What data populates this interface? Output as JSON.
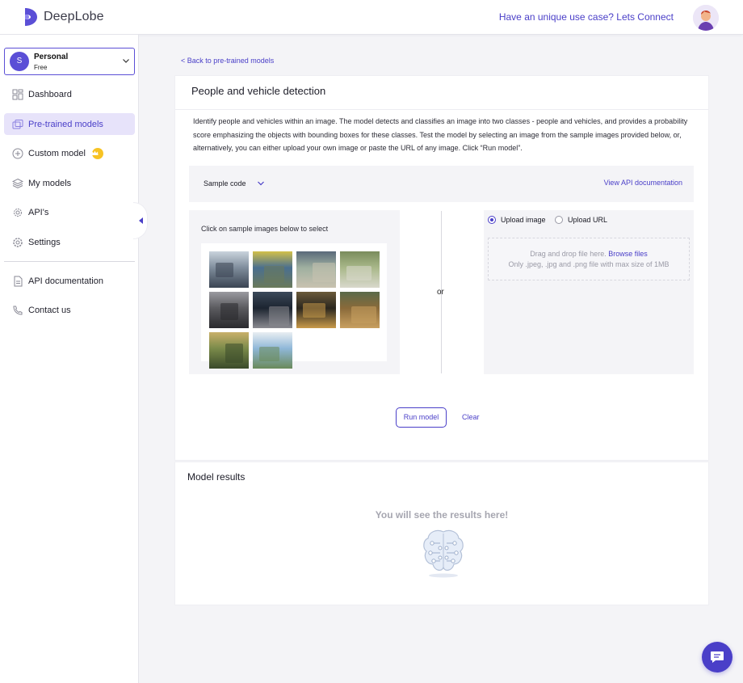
{
  "brand": {
    "name": "DeepLobe",
    "accent": "#4a3fc8",
    "logo_icon": "deeplobe-logo-icon"
  },
  "header": {
    "cta_link": "Have an unique use case? Lets Connect",
    "avatar_icon": "user-avatar-icon"
  },
  "account": {
    "initial": "S",
    "name": "Personal",
    "plan": "Free"
  },
  "sidebar": {
    "items": [
      {
        "label": "Dashboard",
        "icon": "dashboard-icon"
      },
      {
        "label": "Pre-trained models",
        "icon": "pretrained-models-icon",
        "active": true
      },
      {
        "label": "Custom model",
        "icon": "plus-circle-icon",
        "badge": "crown-icon"
      },
      {
        "label": "My models",
        "icon": "layers-icon"
      },
      {
        "label": "API's",
        "icon": "api-gear-icon"
      },
      {
        "label": "Settings",
        "icon": "settings-icon"
      },
      {
        "label": "API documentation",
        "icon": "document-icon"
      },
      {
        "label": "Contact us",
        "icon": "phone-icon"
      }
    ]
  },
  "page": {
    "back_link": "< Back to pre-trained models",
    "title": "People and vehicle detection",
    "description": "Identify people and vehicles within an image. The model detects and classifies an image into two classes - people and vehicles, and provides a probability score emphasizing the objects with bounding boxes for these classes. Test the model by selecting an image from the sample images provided below, or, alternatively, you can either upload your own image or paste the URL of any image. Click “Run model”.",
    "sample_code_label": "Sample code",
    "api_doc_link": "View API documentation",
    "sample_hint": "Click on sample images below to select",
    "or_text": "or",
    "upload_image_label": "Upload image",
    "upload_url_label": "Upload URL",
    "dropzone_text": "Drag and drop file here.",
    "browse_label": "Browse files",
    "dropzone_hint": "Only .jpeg, .jpg and .png file with max size of 1MB",
    "run_button": "Run model",
    "clear_button": "Clear"
  },
  "results": {
    "title": "Model results",
    "empty_text": "You will see the results here!",
    "illustration": "brain-icon"
  },
  "sample_images": [
    {
      "name": "sample-image-buses",
      "colors": [
        "#7f8d9c",
        "#c9d3dc",
        "#3a4452"
      ]
    },
    {
      "name": "sample-image-bus-street",
      "colors": [
        "#4a6f8f",
        "#d2c04a",
        "#6b7a5a"
      ]
    },
    {
      "name": "sample-image-people-walking",
      "colors": [
        "#9fb0a0",
        "#5a6a7a",
        "#c9c2b0"
      ]
    },
    {
      "name": "sample-image-cars-road",
      "colors": [
        "#a9b88a",
        "#7a8c5c",
        "#d9d8cc"
      ]
    },
    {
      "name": "sample-image-car-garage",
      "colors": [
        "#5a5a5e",
        "#9a9aa0",
        "#2a2a2e"
      ]
    },
    {
      "name": "sample-image-person-car",
      "colors": [
        "#1c2430",
        "#3c4a5a",
        "#8a8a90"
      ]
    },
    {
      "name": "sample-image-night-traffic",
      "colors": [
        "#2a261e",
        "#6a5a3a",
        "#c99a4a"
      ]
    },
    {
      "name": "sample-image-autumn-road",
      "colors": [
        "#8a6a3a",
        "#5a6a4a",
        "#c9a060"
      ]
    },
    {
      "name": "sample-image-group-people",
      "colors": [
        "#7a8a4a",
        "#c9b06a",
        "#3a4a2a"
      ]
    },
    {
      "name": "sample-image-van-mountain",
      "colors": [
        "#8fb7d8",
        "#e9eef2",
        "#6a8a5a"
      ]
    }
  ],
  "chat_fab_icon": "chat-bubble-icon"
}
